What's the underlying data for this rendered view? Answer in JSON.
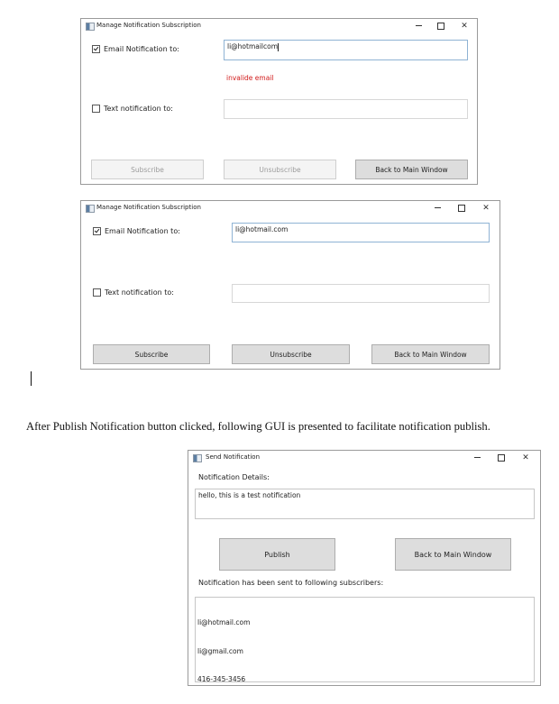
{
  "window1": {
    "title": "Manage Notification Subscription",
    "email_checkbox": {
      "label": "Email Notification to:",
      "checked": true
    },
    "email_value": "li@hotmailcom",
    "error_text": "invalide email",
    "text_checkbox": {
      "label": "Text notification to:",
      "checked": false
    },
    "text_value": "",
    "buttons": {
      "subscribe": "Subscribe",
      "unsubscribe": "Unsubscribe",
      "back": "Back to Main Window"
    },
    "controls": {
      "minimize": "minimize-icon",
      "maximize": "maximize-icon",
      "close": "✕"
    }
  },
  "window2": {
    "title": "Manage Notification Subscription",
    "email_checkbox": {
      "label": "Email Notification to:",
      "checked": true
    },
    "email_value": "li@hotmail.com",
    "text_checkbox": {
      "label": "Text notification to:",
      "checked": false
    },
    "text_value": "",
    "buttons": {
      "subscribe": "Subscribe",
      "unsubscribe": "Unsubscribe",
      "back": "Back to Main Window"
    },
    "controls": {
      "close": "✕"
    }
  },
  "document": {
    "paragraph": "After Publish Notification button clicked, following GUI is presented to facilitate notification publish."
  },
  "window3": {
    "title": "Send Notification",
    "details_label": "Notification Details:",
    "details_value": "hello, this is a test notification",
    "buttons": {
      "publish": "Publish",
      "back": "Back to Main Window"
    },
    "sent_label": "Notification has been sent to following subscribers:",
    "subscribers": [
      "li@hotmail.com",
      "li@gmail.com",
      "416-345-3456"
    ],
    "controls": {
      "close": "✕"
    }
  },
  "colors": {
    "error": "#d11a1a",
    "button_bg": "#dddddd",
    "disabled_text": "#9c9c9c"
  }
}
